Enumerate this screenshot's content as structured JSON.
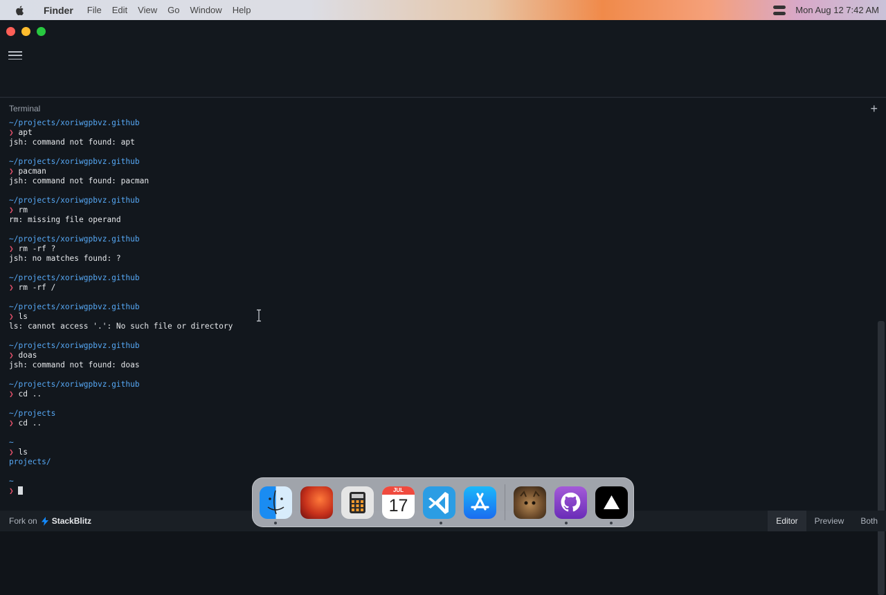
{
  "menubar": {
    "app_name": "Finder",
    "items": [
      "File",
      "Edit",
      "View",
      "Go",
      "Window",
      "Help"
    ],
    "clock": "Mon Aug 12  7:42 AM"
  },
  "terminal": {
    "title": "Terminal",
    "lines": [
      {
        "t": "path",
        "text": "~/projects/xoriwgpbvz.github"
      },
      {
        "t": "cmd",
        "text": "apt"
      },
      {
        "t": "out",
        "text": "jsh: command not found: apt"
      },
      {
        "t": "blank",
        "text": ""
      },
      {
        "t": "path",
        "text": "~/projects/xoriwgpbvz.github"
      },
      {
        "t": "cmd",
        "text": "pacman"
      },
      {
        "t": "out",
        "text": "jsh: command not found: pacman"
      },
      {
        "t": "blank",
        "text": ""
      },
      {
        "t": "path",
        "text": "~/projects/xoriwgpbvz.github"
      },
      {
        "t": "cmd",
        "text": "rm"
      },
      {
        "t": "out",
        "text": "rm: missing file operand"
      },
      {
        "t": "blank",
        "text": ""
      },
      {
        "t": "path",
        "text": "~/projects/xoriwgpbvz.github"
      },
      {
        "t": "cmd",
        "text": "rm -rf ?"
      },
      {
        "t": "out",
        "text": "jsh: no matches found: ?"
      },
      {
        "t": "blank",
        "text": ""
      },
      {
        "t": "path",
        "text": "~/projects/xoriwgpbvz.github"
      },
      {
        "t": "cmd",
        "text": "rm -rf /"
      },
      {
        "t": "blank",
        "text": ""
      },
      {
        "t": "path",
        "text": "~/projects/xoriwgpbvz.github"
      },
      {
        "t": "cmd",
        "text": "ls"
      },
      {
        "t": "out",
        "text": "ls: cannot access '.': No such file or directory"
      },
      {
        "t": "blank",
        "text": ""
      },
      {
        "t": "path",
        "text": "~/projects/xoriwgpbvz.github"
      },
      {
        "t": "cmd",
        "text": "doas"
      },
      {
        "t": "out",
        "text": "jsh: command not found: doas"
      },
      {
        "t": "blank",
        "text": ""
      },
      {
        "t": "path",
        "text": "~/projects/xoriwgpbvz.github"
      },
      {
        "t": "cmd",
        "text": "cd .."
      },
      {
        "t": "blank",
        "text": ""
      },
      {
        "t": "path",
        "text": "~/projects"
      },
      {
        "t": "cmd",
        "text": "cd .."
      },
      {
        "t": "blank",
        "text": ""
      },
      {
        "t": "path",
        "text": "~"
      },
      {
        "t": "cmd",
        "text": "ls"
      },
      {
        "t": "dir",
        "text": "projects/"
      },
      {
        "t": "blank",
        "text": ""
      },
      {
        "t": "path",
        "text": "~"
      },
      {
        "t": "input",
        "text": ""
      }
    ]
  },
  "statusbar": {
    "fork_label": "Fork on",
    "brand": "StackBlitz",
    "tabs": [
      "Editor",
      "Preview",
      "Both"
    ],
    "active_tab": "Editor"
  },
  "dock": {
    "calendar_month": "JUL",
    "calendar_day": "17",
    "apps": [
      "finder-icon",
      "macos-wallpaper-icon",
      "calculator-icon",
      "calendar-icon",
      "vscode-icon",
      "app-store-icon",
      "cat-photo-icon",
      "github-icon",
      "vercel-icon"
    ]
  }
}
